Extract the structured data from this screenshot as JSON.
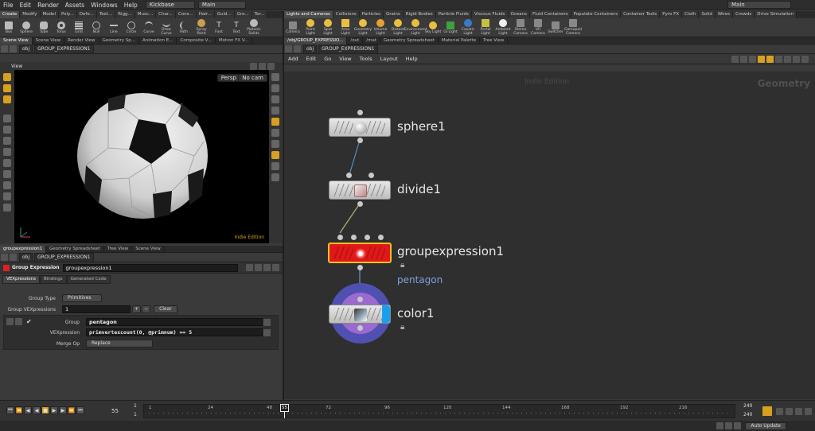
{
  "menu": {
    "items": [
      "File",
      "Edit",
      "Render",
      "Assets",
      "Windows",
      "Help"
    ],
    "desktop": "Kickbase",
    "context": "Main",
    "right_context": "Main"
  },
  "left_shelf": {
    "tabs": [
      "Create",
      "Modify",
      "Model",
      "Poly...",
      "Defo...",
      "Text...",
      "Rigg...",
      "Musc...",
      "Char...",
      "Cons...",
      "Hair...",
      "Guid...",
      "Gro...",
      "Ter..."
    ],
    "tools": [
      "Box",
      "Sphere",
      "Tube",
      "Torus",
      "Grid",
      "Null",
      "Line",
      "Circle",
      "Curve",
      "Draw Curve",
      "Path",
      "Spray Paint",
      "Font",
      "Text",
      "Platonic Solids"
    ]
  },
  "right_shelf": {
    "tabs": [
      "Lights and Cameras",
      "Collisions",
      "Particles",
      "Grains",
      "Rigid Bodies",
      "Particle Fluids",
      "Viscous Fluids",
      "Oceans",
      "Fluid Containers",
      "Populate Containers",
      "Container Tools",
      "Pyro FX",
      "Cloth",
      "Solid",
      "Wires",
      "Crowds",
      "Drive Simulation"
    ],
    "tools": [
      "Camera",
      "Point Light",
      "Spot Light",
      "Area Light",
      "Geometry Light",
      "Volume Light",
      "Distant Light",
      "Environment Light",
      "Sky Light",
      "GI Light",
      "Caustic Light",
      "Portal Light",
      "Ambient Light",
      "Stereo Camera",
      "VR Camera",
      "Switcher",
      "Gamepad Camera"
    ]
  },
  "left_panel_tabs": [
    "Scene View",
    "Scene View",
    "Render View",
    "Geometry Sp...",
    "Animation E...",
    "Composite V...",
    "Motion FX V..."
  ],
  "right_panel_tabs": [
    "/obj/GROUP_EXPRESSIO...",
    "/out",
    "/mat",
    "Geometry Spreadsheet",
    "Material Palette",
    "Tree View"
  ],
  "path": {
    "root": "obj",
    "node": "GROUP_EXPRESSION1"
  },
  "viewport": {
    "title": "View",
    "persp": "Persp",
    "cam": "No cam",
    "edition": "Indie Edition"
  },
  "param_tabs_row": [
    "groupexpression1",
    "Geometry Spreadsheet",
    "Tree View",
    "Scene View"
  ],
  "params": {
    "op_type": "Group Expression",
    "op_name": "groupexpression1",
    "tabs": [
      "VEXpressions",
      "Bindings",
      "Generated Code"
    ],
    "group_type_label": "Group Type",
    "group_type": "Primitives",
    "group_vexpr_label": "Group VEXpressions",
    "group_vexpr_count": "1",
    "clear": "Clear",
    "group_label": "Group",
    "group": "pentagon",
    "vexpr_label": "VEXpression",
    "vexpr": "primvertexcount(0, @primnum) == 5",
    "merge_label": "Merge Op",
    "merge": "Replace"
  },
  "network": {
    "menu": [
      "Add",
      "Edit",
      "Go",
      "View",
      "Tools",
      "Layout",
      "Help"
    ],
    "watermark": "Indie Edition",
    "context_label": "Geometry",
    "nodes": [
      {
        "name": "sphere1"
      },
      {
        "name": "divide1"
      },
      {
        "name": "groupexpression1",
        "group": "pentagon"
      },
      {
        "name": "color1"
      }
    ]
  },
  "timeline": {
    "frame": "55",
    "start": "1",
    "start2": "1",
    "end": "240",
    "end2": "240",
    "current_marker": "55",
    "ticks": [
      "1",
      "24",
      "48",
      "72",
      "96",
      "120",
      "144",
      "168",
      "192",
      "216"
    ],
    "auto_update": "Auto Update"
  },
  "colors": {
    "accent_yellow": "#d8a020",
    "node_selected_red": "#e01818",
    "color_node_purple": "#5050b0",
    "group_label_blue": "#7aa2e0"
  }
}
